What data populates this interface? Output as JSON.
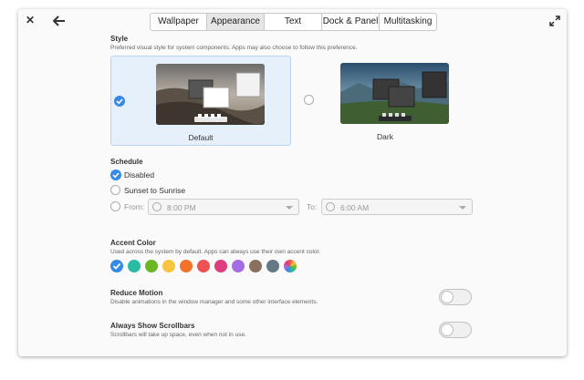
{
  "tabs": [
    {
      "label": "Wallpaper",
      "active": false
    },
    {
      "label": "Appearance",
      "active": true
    },
    {
      "label": "Text",
      "active": false
    },
    {
      "label": "Dock & Panel",
      "active": false
    },
    {
      "label": "Multitasking",
      "active": false
    }
  ],
  "style": {
    "title": "Style",
    "description": "Preferred visual style for system components. Apps may also choose to follow this preference.",
    "options": [
      {
        "label": "Default",
        "selected": true
      },
      {
        "label": "Dark",
        "selected": false
      }
    ]
  },
  "schedule": {
    "title": "Schedule",
    "options": [
      {
        "label": "Disabled",
        "selected": true
      },
      {
        "label": "Sunset to Sunrise",
        "selected": false
      },
      {
        "label": "From:",
        "selected": false
      }
    ],
    "from_value": "8:00 PM",
    "to_label": "To:",
    "to_value": "6:00 AM"
  },
  "accent": {
    "title": "Accent Color",
    "description": "Used across the system by default. Apps can always use their own accent color.",
    "colors": [
      {
        "name": "blue",
        "hex": "#3689e6",
        "selected": true
      },
      {
        "name": "mint",
        "hex": "#28bca3",
        "selected": false
      },
      {
        "name": "green",
        "hex": "#68b723",
        "selected": false
      },
      {
        "name": "yellow",
        "hex": "#f9c440",
        "selected": false
      },
      {
        "name": "orange",
        "hex": "#f37329",
        "selected": false
      },
      {
        "name": "red",
        "hex": "#ed5353",
        "selected": false
      },
      {
        "name": "pink",
        "hex": "#de3e80",
        "selected": false
      },
      {
        "name": "purple",
        "hex": "#a56de2",
        "selected": false
      },
      {
        "name": "brown",
        "hex": "#8a715e",
        "selected": false
      },
      {
        "name": "gray",
        "hex": "#667885",
        "selected": false
      },
      {
        "name": "auto",
        "hex": "multicolor",
        "selected": false
      }
    ]
  },
  "reduce_motion": {
    "title": "Reduce Motion",
    "description": "Disable animations in the window manager and some other interface elements.",
    "enabled": false
  },
  "scrollbars": {
    "title": "Always Show Scrollbars",
    "description": "Scrollbars will take up space, even when not in use.",
    "enabled": false
  },
  "icons": {
    "close": "close-icon",
    "back": "back-arrow-icon",
    "maximize": "maximize-icon"
  }
}
